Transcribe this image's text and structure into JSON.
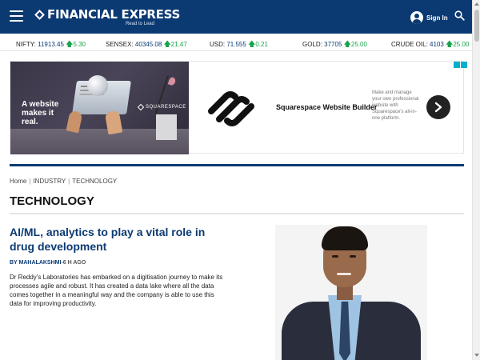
{
  "header": {
    "logo_name": "FINANCIAL EXPRESS",
    "logo_tagline": "Read to Lead",
    "signin_label": "Sign In",
    "brand_color": "#0b3a73"
  },
  "ticker": [
    {
      "name": "NIFTY:",
      "value": "11913.45",
      "change": "5.30",
      "direction": "up"
    },
    {
      "name": "SENSEX:",
      "value": "40345.08",
      "change": "21.47",
      "direction": "up"
    },
    {
      "name": "USD:",
      "value": "71.555",
      "change": "0.21",
      "direction": "up"
    },
    {
      "name": "GOLD:",
      "value": "37705",
      "change": "25.00",
      "direction": "up"
    },
    {
      "name": "CRUDE OIL:",
      "value": "4103",
      "change": "25.00",
      "direction": "up"
    }
  ],
  "ad": {
    "tagline": "A website makes it real.",
    "brand_word": "SQUARESPACE",
    "title": "Squarespace Website Builder",
    "description": "Make and manage your own professional website with Squarespace's all-in-one platform."
  },
  "breadcrumb": [
    "Home",
    "INDUSTRY",
    "TECHNOLOGY"
  ],
  "section_title": "TECHNOLOGY",
  "article": {
    "headline": "AI/ML, analytics to play a vital role in drug development",
    "author": "BY MAHALAKSHMI",
    "time_ago": "-6 H AGO",
    "summary": "Dr Reddy’s Laboratories has embarked on a digitisation journey to make its processes agile and robust. It has created a data lake where all the data comes together in a meaningful way and the company is able to use this data for improving productivity."
  },
  "colors": {
    "up": "#16a34a",
    "ad_badge": "#00aecd"
  }
}
